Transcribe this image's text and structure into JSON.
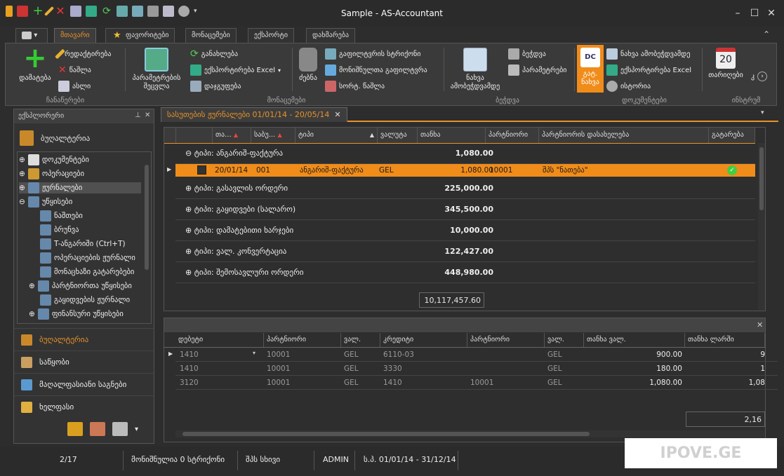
{
  "window": {
    "title": "Sample - AS-Accountant"
  },
  "ribbon": {
    "app_menu": "▾",
    "tabs": [
      "მთავარი",
      "ფავორიტები",
      "მონაცემები",
      "ექსპორტი",
      "დახმარება"
    ],
    "groups": [
      "ჩანაწერები",
      "მონაცემები",
      "ბეჭდვა",
      "დოკუმენტები",
      "ინსტრუმ"
    ],
    "buttons": {
      "add": "დამატება",
      "edit": "რედაქტირება",
      "delete": "წაშლა",
      "copy": "ასლი",
      "params_refresh_1": "პარამეტრების",
      "params_refresh_2": "შეცვლა",
      "refresh": "განახლება",
      "export_excel": "ექსპორტირება Excel",
      "grouping": "დაჯგუფება",
      "search": "ძებნა",
      "filter_row": "გაფილტვრის სტრიქონი",
      "marked_filter": "მონიშნულთა გაფილტვრა",
      "sort_delete": "სორტ. წაშლა",
      "preview_1": "ნახვა",
      "preview_2": "ამობეჭდვამდე",
      "print": "ბეჭდვა",
      "print_params": "პარამეტრები",
      "dc_1": "გატ.",
      "dc_2": "ნახვა",
      "doc_preview": "ნახვა ამობეჭდვამდე",
      "doc_export": "ექსპორტირება Excel",
      "history": "ისტორია",
      "calendar": "თარიღები",
      "calendar_num": "20",
      "tools_more": "კ"
    }
  },
  "explorer": {
    "title": "ექსპლორერი",
    "section": "ბუღალტერია",
    "tree": [
      "დოკუმენტები",
      "ოპერაციები",
      "ჟურნალები",
      "უწყისები",
      "ნაშთები",
      "ბრუნვა",
      "T-ანგარიში (Ctrl+T)",
      "ოპერაციების ჟურნალი",
      "მონაცხაზი გატარებები",
      "პარტნიორთა უწყისები",
      "გაყიდვების ჟურნალი",
      "ფინანსური უწყისები"
    ],
    "nav": [
      "ბუღალტერია",
      "საწყობი",
      "მაღალფასიანი საგნები",
      "ხელფასი"
    ]
  },
  "document_tab": {
    "label": "სასუთების ჟურნალები 01/01/14 - 20/05/14",
    "close": "✕"
  },
  "journal": {
    "columns": [
      "თა...",
      "საბუ...",
      "ტიპი",
      "ვალუტა",
      "თანხა",
      "პარტნიორი",
      "პარტნიორის დასახელება",
      "გატარება"
    ],
    "groups": [
      {
        "label": "ტიპი: ანგარიშ-ფაქტურა",
        "amount": "1,080.00"
      },
      {
        "label": "ტიპი: გასავლის ორდერი",
        "amount": "225,000.00"
      },
      {
        "label": "ტიპი: გაყიდვები (სალარო)",
        "amount": "345,500.00"
      },
      {
        "label": "ტიპი: დამატებითი ხარჯები",
        "amount": "10,000.00"
      },
      {
        "label": "ტიპი: ვალ. კონვერტაცია",
        "amount": "122,427.00"
      },
      {
        "label": "ტიპი: შემოსავლური ორდერი",
        "amount": "448,980.00"
      }
    ],
    "selected_row": {
      "date": "20/01/14",
      "number": "001",
      "type": "ანგარიშ-ფაქტურა",
      "currency": "GEL",
      "amount": "1,080.00",
      "partner": "10001",
      "partner_name": "შპს \"ნათება\""
    },
    "total": "10,117,457.60"
  },
  "entries": {
    "columns": [
      "დებეტი",
      "პარტნიორი",
      "ვალ.",
      "კრედიტი",
      "პარტნიორი",
      "ვალ.",
      "თანხა ვალ.",
      "თანხა ლარში"
    ],
    "rows": [
      {
        "debit": "1410",
        "partner": "10001",
        "cur": "GEL",
        "credit": "6110-03",
        "partner2": "",
        "cur2": "GEL",
        "amount": "900.00",
        "amount_gel": "9"
      },
      {
        "debit": "1410",
        "partner": "10001",
        "cur": "GEL",
        "credit": "3330",
        "partner2": "",
        "cur2": "GEL",
        "amount": "180.00",
        "amount_gel": "1"
      },
      {
        "debit": "3120",
        "partner": "10001",
        "cur": "GEL",
        "credit": "1410",
        "partner2": "10001",
        "cur2": "GEL",
        "amount": "1,080.00",
        "amount_gel": "1,08"
      }
    ],
    "total": "2,16"
  },
  "status": {
    "page": "2/17",
    "marked": "მონიშნულია 0 სტრიქონი",
    "company": "შპს სხივი",
    "user": "ADMIN",
    "period": "ს.პ. 01/01/14 - 31/12/14"
  },
  "watermark": "IPOVE.GE",
  "colors": {
    "accent": "#f08c1a",
    "background": "#2d2d2d"
  }
}
